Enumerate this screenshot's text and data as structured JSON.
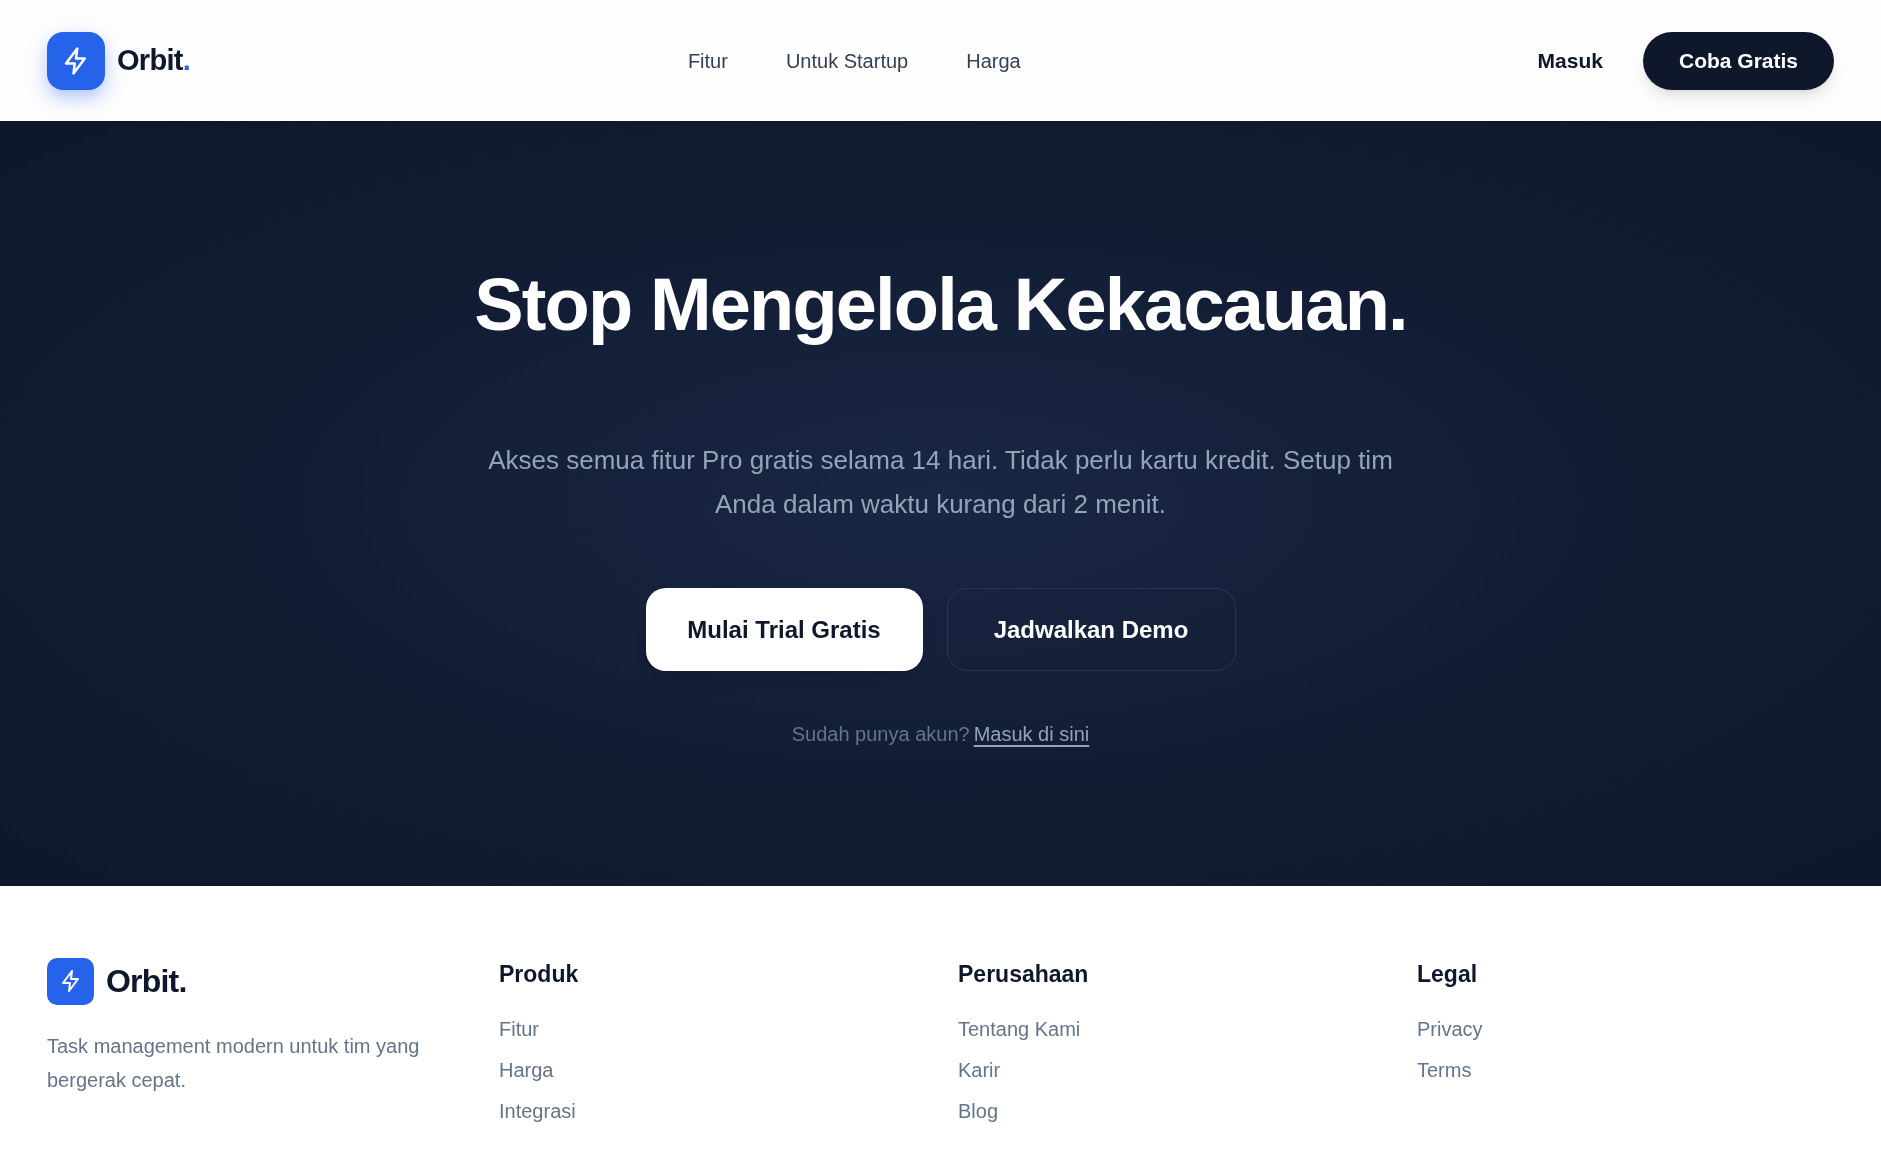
{
  "header": {
    "brand": {
      "name": "Orbit.",
      "accent_dot": true
    },
    "nav": [
      "Fitur",
      "Untuk Startup",
      "Harga"
    ],
    "login": "Masuk",
    "cta": "Coba Gratis"
  },
  "hero": {
    "title": "Stop Mengelola Kekacauan.",
    "subtitle": "Akses semua fitur Pro gratis selama 14 hari. Tidak perlu kartu kredit. Setup tim Anda dalam waktu kurang dari 2 menit.",
    "buttons": [
      {
        "label": "Mulai Trial Gratis",
        "kind": "primary"
      },
      {
        "label": "Jadwalkan Demo",
        "kind": "outline"
      }
    ],
    "signin_prompt": "Sudah punya akun?",
    "signin_link": "Masuk di sini"
  },
  "footer": {
    "brand": {
      "name": "Orbit.",
      "accent_dot": false
    },
    "tagline": "Task management modern untuk tim yang bergerak cepat.",
    "columns": [
      {
        "heading": "Produk",
        "links": [
          "Fitur",
          "Harga",
          "Integrasi"
        ]
      },
      {
        "heading": "Perusahaan",
        "links": [
          "Tentang Kami",
          "Karir",
          "Blog"
        ]
      },
      {
        "heading": "Legal",
        "links": [
          "Privacy",
          "Terms"
        ]
      }
    ]
  }
}
